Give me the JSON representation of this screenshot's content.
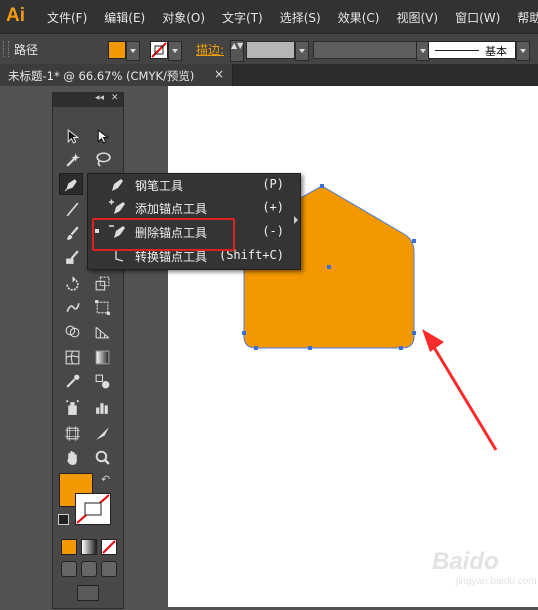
{
  "app": {
    "logo": "Ai"
  },
  "menubar": {
    "items": [
      "文件(F)",
      "编辑(E)",
      "对象(O)",
      "文字(T)",
      "选择(S)",
      "效果(C)",
      "视图(V)",
      "窗口(W)",
      "帮助("
    ]
  },
  "control_bar": {
    "selection_label": "路径",
    "stroke_label": "描边:",
    "spinner_glyph": "▲▼",
    "brush_label": "基本",
    "fill_color": "#f39800"
  },
  "tab": {
    "title": "未标题-1* @ 66.67% (CMYK/预览)",
    "close": "×"
  },
  "panel": {
    "collapse": "◂◂",
    "close": "✕"
  },
  "toolbox": {
    "fill_color": "#f39800",
    "stroke_color": "#ffffff",
    "swap": "↶",
    "tools": [
      "selection-tool",
      "direct-selection-tool",
      "magic-wand-tool",
      "lasso-tool",
      "pen-tool",
      "type-tool",
      "line-tool",
      "rectangle-tool",
      "paintbrush-tool",
      "pencil-tool",
      "blob-brush-tool",
      "eraser-tool",
      "rotate-tool",
      "scale-tool",
      "warp-tool",
      "free-transform-tool",
      "shape-builder-tool",
      "perspective-grid-tool",
      "mesh-tool",
      "gradient-tool",
      "eyedropper-tool",
      "blend-tool",
      "symbol-sprayer-tool",
      "column-graph-tool",
      "artboard-tool",
      "slice-tool",
      "hand-tool",
      "zoom-tool"
    ]
  },
  "flyout": {
    "items": [
      {
        "label": "钢笔工具",
        "shortcut": "(P)",
        "icon": "pen-icon"
      },
      {
        "label": "添加锚点工具",
        "shortcut": "(+)",
        "icon": "add-anchor-icon"
      },
      {
        "label": "删除锚点工具",
        "shortcut": "(-)",
        "icon": "delete-anchor-icon"
      },
      {
        "label": "转换锚点工具",
        "shortcut": "(Shift+C)",
        "icon": "convert-anchor-icon"
      }
    ],
    "highlighted": "删除锚点工具"
  },
  "canvas": {
    "shape_fill": "#f39800",
    "shape_stroke": "#4a7bd8",
    "annotation_color": "#ff2a2a"
  },
  "watermark": {
    "text": "Baido",
    "subtitle": "jingyan.baidu.com"
  }
}
